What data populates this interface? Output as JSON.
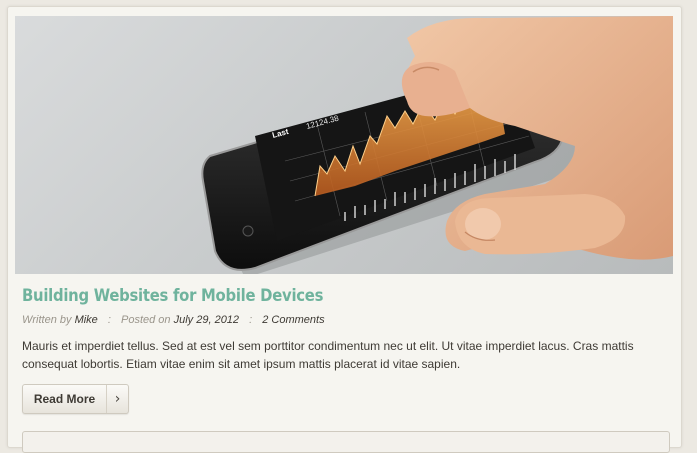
{
  "post": {
    "title": "Building Websites for Mobile Devices",
    "meta": {
      "written_by_label": "Written by",
      "author": "Mike",
      "posted_on_label": "Posted on",
      "date": "July 29, 2012",
      "comments": "2 Comments",
      "separator": ":"
    },
    "excerpt": "Mauris et imperdiet tellus. Sed at est vel sem porttitor condimentum nec ut elit. Ut vitae imperdiet lacus. Cras mattis consequat lobortis. Etiam vitae enim sit amet ipsum mattis placerat id vitae sapien.",
    "read_more_label": "Read More",
    "read_more_icon": "chevron-right-icon",
    "image": {
      "screen_label_last": "Last",
      "screen_value": "12124.38"
    }
  },
  "colors": {
    "title": "#6fb39d",
    "background": "#ece9e2",
    "card": "#f6f5f0"
  }
}
